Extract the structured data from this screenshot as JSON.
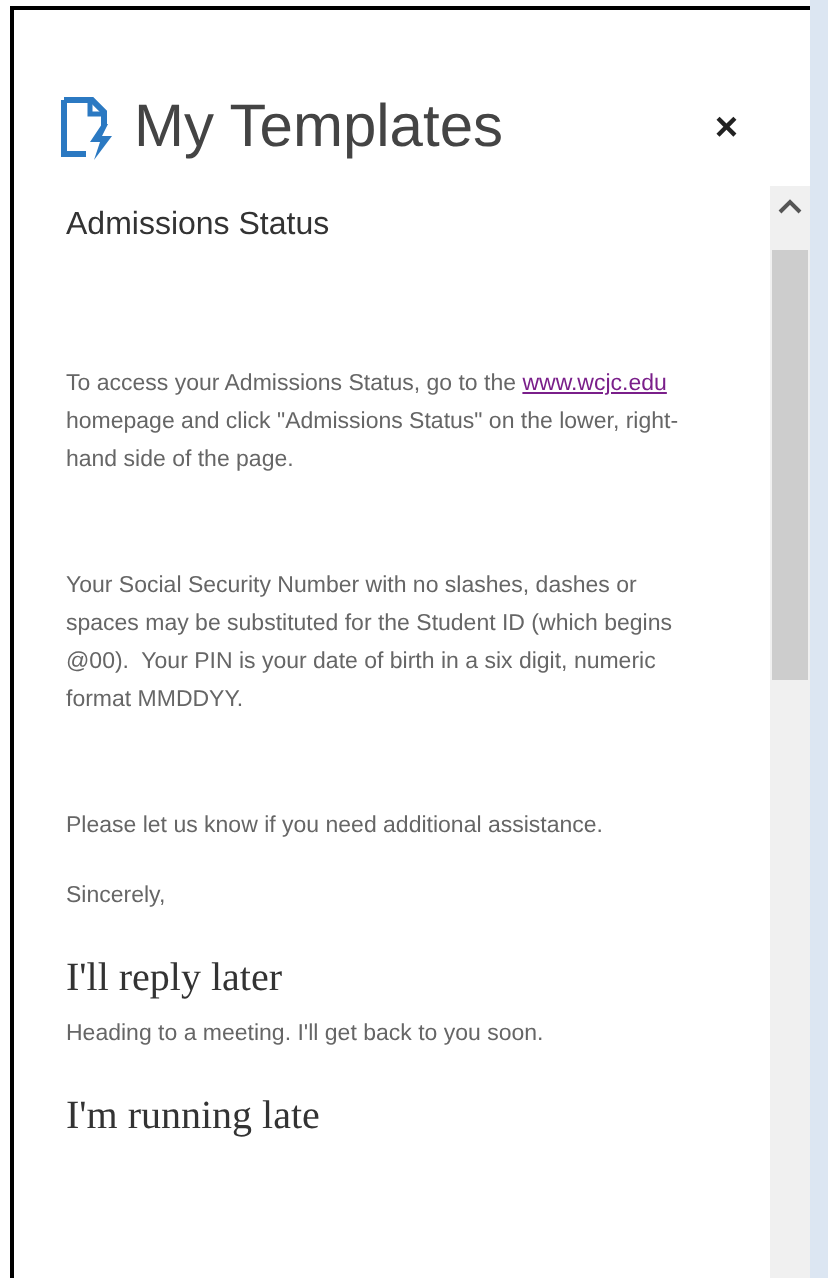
{
  "title": "My Templates",
  "close": "×",
  "templates": [
    {
      "title": "Admissions Status",
      "paragraphs": [
        {
          "kind": "link_text",
          "before": "To access your Admissions Status, go to the ",
          "link": "www.wcjc.edu",
          "after": " homepage and click \"Admissions Status\" on the lower, right-hand side of the page."
        },
        {
          "kind": "text",
          "text": "Your Social Security Number with no slashes, dashes or spaces may be substituted for the Student ID (which begins @00).  Your PIN is your date of birth in a six digit, numeric format MMDDYY."
        },
        {
          "kind": "text",
          "text": "Please let us know if you need additional assistance."
        },
        {
          "kind": "closing",
          "text": "Sincerely,"
        }
      ]
    },
    {
      "title": "I'll reply later",
      "paragraphs": [
        {
          "kind": "summary",
          "text": "Heading to a meeting. I'll get back to you soon."
        }
      ]
    },
    {
      "title": "I'm running late"
    }
  ]
}
